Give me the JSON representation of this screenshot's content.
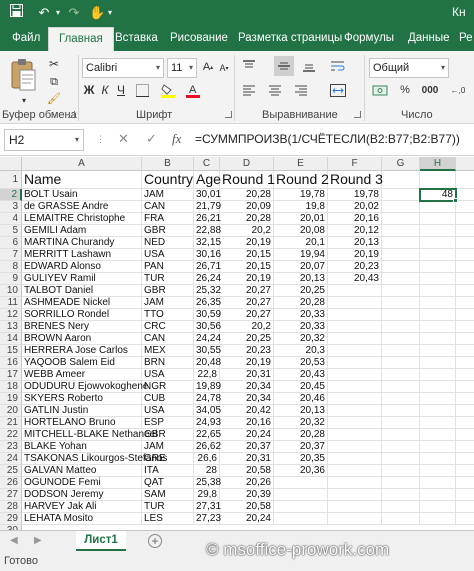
{
  "titlebar": {
    "save_icon": "save-icon",
    "undo_icon": "undo-icon",
    "redo_icon": "redo-icon",
    "touch_icon": "touch-mode-icon",
    "doc_title": "Кн"
  },
  "tabs": [
    "Файл",
    "Главная",
    "Вставка",
    "Рисование",
    "Разметка страницы",
    "Формулы",
    "Данные",
    "Ре"
  ],
  "ribbon": {
    "paste_label": "Вставить",
    "clipboard_label": "Буфер обмена",
    "font_label": "Шрифт",
    "font_name": "Calibri",
    "font_size": "11",
    "bold": "Ж",
    "italic": "К",
    "underline": "Ч",
    "align_label": "Выравнивание",
    "number_format": "Общий",
    "number_label": "Число"
  },
  "formula_bar": {
    "name_box": "H2",
    "cancel": "✕",
    "enter": "✓",
    "fx": "fx",
    "formula": "=СУММПРОИЗВ(1/СЧЁТЕСЛИ(B2:B77;B2:B77))"
  },
  "columns": [
    "A",
    "B",
    "C",
    "D",
    "E",
    "F",
    "G",
    "H",
    "I"
  ],
  "header_row": [
    "Name",
    "Country",
    "Age",
    "Round 1",
    "Round 2",
    "Round 3",
    "",
    "",
    ""
  ],
  "rows": [
    [
      "BOLT Usain",
      "JAM",
      "30,01",
      "20,28",
      "19,78",
      "19,78",
      "",
      "48",
      ""
    ],
    [
      "de GRASSE Andre",
      "CAN",
      "21,79",
      "20,09",
      "19,8",
      "20,02",
      "",
      "",
      ""
    ],
    [
      "LEMAITRE Christophe",
      "FRA",
      "26,21",
      "20,28",
      "20,01",
      "20,16",
      "",
      "",
      ""
    ],
    [
      "GEMILI Adam",
      "GBR",
      "22,88",
      "20,2",
      "20,08",
      "20,12",
      "",
      "",
      ""
    ],
    [
      "MARTINA Churandy",
      "NED",
      "32,15",
      "20,19",
      "20,1",
      "20,13",
      "",
      "",
      ""
    ],
    [
      "MERRITT Lashawn",
      "USA",
      "30,16",
      "20,15",
      "19,94",
      "20,19",
      "",
      "",
      ""
    ],
    [
      "EDWARD Alonso",
      "PAN",
      "26,71",
      "20,15",
      "20,07",
      "20,23",
      "",
      "",
      ""
    ],
    [
      "GULIYEV Ramil",
      "TUR",
      "26,24",
      "20,19",
      "20,13",
      "20,43",
      "",
      "",
      ""
    ],
    [
      "TALBOT Daniel",
      "GBR",
      "25,32",
      "20,27",
      "20,25",
      "",
      "",
      "",
      ""
    ],
    [
      "ASHMEADE Nickel",
      "JAM",
      "26,35",
      "20,27",
      "20,28",
      "",
      "",
      "",
      ""
    ],
    [
      "SORRILLO Rondel",
      "TTO",
      "30,59",
      "20,27",
      "20,33",
      "",
      "",
      "",
      ""
    ],
    [
      "BRENES Nery",
      "CRC",
      "30,56",
      "20,2",
      "20,33",
      "",
      "",
      "",
      ""
    ],
    [
      "BROWN Aaron",
      "CAN",
      "24,24",
      "20,25",
      "20,32",
      "",
      "",
      "",
      ""
    ],
    [
      "HERRERA Jose Carlos",
      "MEX",
      "30,55",
      "20,23",
      "20,3",
      "",
      "",
      "",
      ""
    ],
    [
      "YAQOOB Salem Eid",
      "BRN",
      "20,48",
      "20,19",
      "20,53",
      "",
      "",
      "",
      ""
    ],
    [
      "WEBB Ameer",
      "USA",
      "22,8",
      "20,31",
      "20,43",
      "",
      "",
      "",
      ""
    ],
    [
      "ODUDURU Ejowvokoghene",
      "NGR",
      "19,89",
      "20,34",
      "20,45",
      "",
      "",
      "",
      ""
    ],
    [
      "SKYERS Roberto",
      "CUB",
      "24,78",
      "20,34",
      "20,46",
      "",
      "",
      "",
      ""
    ],
    [
      "GATLIN Justin",
      "USA",
      "34,05",
      "20,42",
      "20,13",
      "",
      "",
      "",
      ""
    ],
    [
      "HORTELANO Bruno",
      "ESP",
      "24,93",
      "20,16",
      "20,32",
      "",
      "",
      "",
      ""
    ],
    [
      "MITCHELL-BLAKE Nethaneel",
      "GBR",
      "22,65",
      "20,24",
      "20,28",
      "",
      "",
      "",
      ""
    ],
    [
      "BLAKE Yohan",
      "JAM",
      "26,62",
      "20,37",
      "20,37",
      "",
      "",
      "",
      ""
    ],
    [
      "TSAKONAS Likourgos-Stefanos",
      "GRE",
      "26,6",
      "20,31",
      "20,35",
      "",
      "",
      "",
      ""
    ],
    [
      "GALVAN Matteo",
      "ITA",
      "28",
      "20,58",
      "20,36",
      "",
      "",
      "",
      ""
    ],
    [
      "OGUNODE Femi",
      "QAT",
      "25,38",
      "20,26",
      "",
      "",
      "",
      "",
      ""
    ],
    [
      "DODSON Jeremy",
      "SAM",
      "29,8",
      "20,39",
      "",
      "",
      "",
      "",
      ""
    ],
    [
      "HARVEY Jak Ali",
      "TUR",
      "27,31",
      "20,58",
      "",
      "",
      "",
      "",
      ""
    ],
    [
      "LEHATA Mosito",
      "LES",
      "27,23",
      "20,24",
      "",
      "",
      "",
      "",
      ""
    ]
  ],
  "row_numbers": [
    "1",
    "2",
    "3",
    "4",
    "5",
    "6",
    "7",
    "8",
    "9",
    "10",
    "11",
    "12",
    "13",
    "14",
    "15",
    "16",
    "17",
    "18",
    "19",
    "20",
    "21",
    "22",
    "23",
    "24",
    "25",
    "26",
    "27",
    "28",
    "29",
    "30"
  ],
  "sheet": {
    "tab_label": "Лист1",
    "add_label": "+"
  },
  "status": {
    "text": "Готово"
  },
  "watermark": "© msoffice-prowork.com",
  "colors": {
    "accent": "#217346",
    "ribbon_bg": "#f3f3f3"
  }
}
